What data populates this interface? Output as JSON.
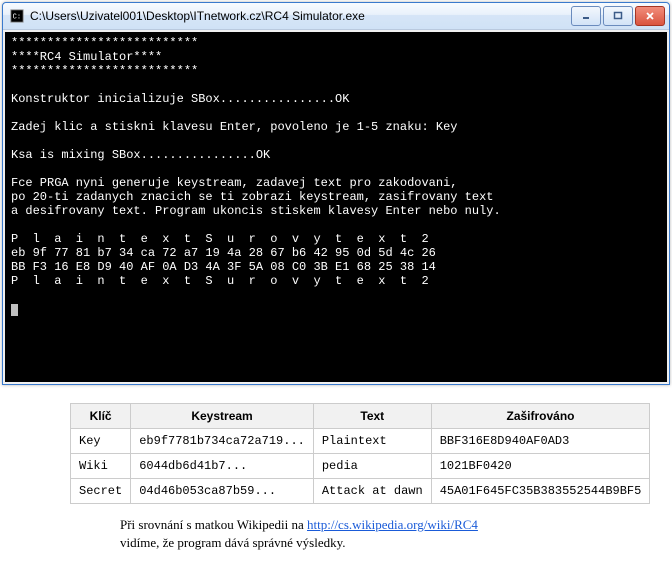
{
  "window": {
    "title": "C:\\Users\\Uzivatel001\\Desktop\\ITnetwork.cz\\RC4 Simulator.exe",
    "minimize": "—",
    "maximize": "▭",
    "close": "X"
  },
  "console": {
    "l1": "**************************",
    "l2": "****RC4 Simulator****",
    "l3": "**************************",
    "l4": "",
    "l5": "Konstruktor inicializuje SBox................OK",
    "l6": "",
    "l7": "Zadej klic a stiskni klavesu Enter, povoleno je 1-5 znaku: Key",
    "l8": "",
    "l9": "Ksa is mixing SBox................OK",
    "l10": "",
    "l11": "Fce PRGA nyni generuje keystream, zadavej text pro zakodovani,",
    "l12": "po 20-ti zadanych znacich se ti zobrazi keystream, zasifrovany text",
    "l13": "a desifrovany text. Program ukoncis stiskem klavesy Enter nebo nuly.",
    "l14": "",
    "l15": "P  l  a  i  n  t  e  x  t  S  u  r  o  v  y  t  e  x  t  2",
    "l16": "eb 9f 77 81 b7 34 ca 72 a7 19 4a 28 67 b6 42 95 0d 5d 4c 26",
    "l17": "BB F3 16 E8 D9 40 AF 0A D3 4A 3F 5A 08 C0 3B E1 68 25 38 14",
    "l18": "P  l  a  i  n  t  e  x  t  S  u  r  o  v  y  t  e  x  t  2",
    "l19": ""
  },
  "table": {
    "headers": {
      "h1": "Klíč",
      "h2": "Keystream",
      "h3": "Text",
      "h4": "Zašifrováno"
    },
    "rows": [
      {
        "c1": "Key",
        "c2": "eb9f7781b734ca72a719...",
        "c3": "Plaintext",
        "c4": "BBF316E8D940AF0AD3"
      },
      {
        "c1": "Wiki",
        "c2": "6044db6d41b7...",
        "c3": "pedia",
        "c4": "1021BF0420"
      },
      {
        "c1": "Secret",
        "c2": "04d46b053ca87b59...",
        "c3": "Attack at dawn",
        "c4": "45A01F645FC35B383552544B9BF5"
      }
    ]
  },
  "caption": {
    "part1": "Při srovnání s matkou Wikipedii na ",
    "link_text": "http://cs.wikipedia.org/wiki/RC4",
    "part2": "vidíme, že program dává správné výsledky."
  }
}
